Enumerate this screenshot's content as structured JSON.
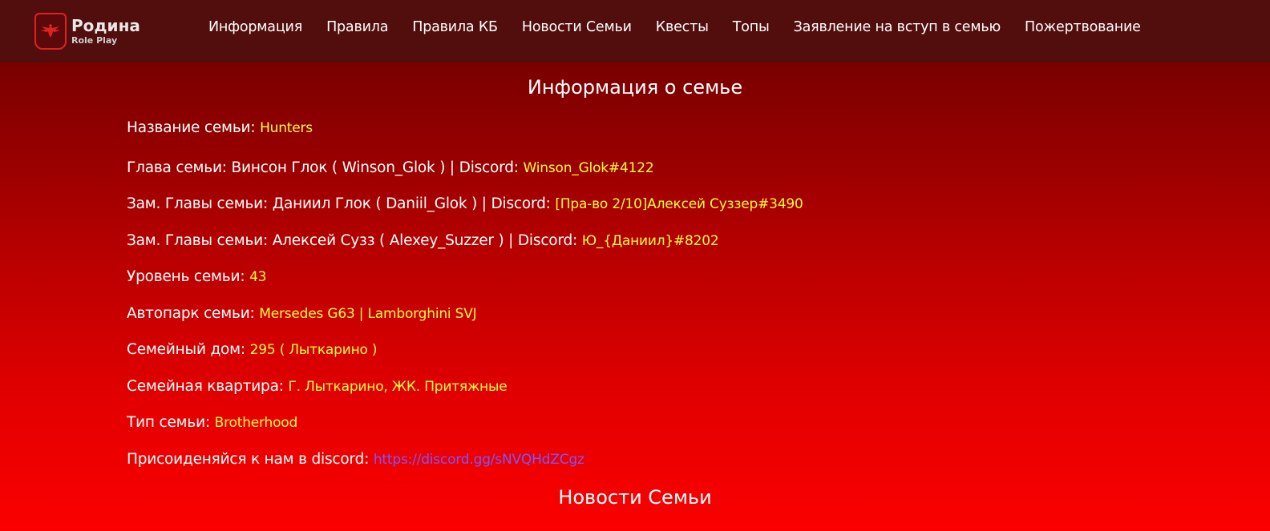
{
  "brand": {
    "title": "Родина",
    "subtitle": "Role Play",
    "logo_icon": "eagle-emblem-icon"
  },
  "nav": {
    "items": [
      {
        "label": "Информация"
      },
      {
        "label": "Правила"
      },
      {
        "label": "Правила КБ"
      },
      {
        "label": "Новости Семьи"
      },
      {
        "label": "Квесты"
      },
      {
        "label": "Топы"
      },
      {
        "label": "Заявление на вступ в семью"
      },
      {
        "label": "Пожертвование"
      }
    ]
  },
  "family_info": {
    "heading": "Информация о семье",
    "rows": [
      {
        "label": "Название семьи:",
        "value": "Hunters"
      },
      {
        "label": "Глава семьи: Винсон Глок ( Winson_Glok ) | Discord:",
        "value": "Winson_Glok#4122"
      },
      {
        "label": "Зам. Главы семьи: Даниил Глок ( Daniil_Glok ) | Discord:",
        "value": "[Пра-во 2/10]Алексей Суззер#3490"
      },
      {
        "label": "Зам. Главы семьи: Алексей Сузз ( Alexey_Suzzer ) | Discord:",
        "value": "Ю_{Даниил}#8202"
      },
      {
        "label": "Уровень семьи:",
        "value": "43"
      },
      {
        "label": "Автопарк семьи:",
        "value": "Mersedes G63 | Lamborghini SVJ"
      },
      {
        "label": "Семейный дом:",
        "value": "295 ( Лыткарино )"
      },
      {
        "label": "Семейная квартира:",
        "value": "Г. Лыткарино, ЖК. Притяжные"
      },
      {
        "label": "Тип семьи:",
        "value": "Brotherhood"
      }
    ],
    "discord": {
      "label": "Присоиденяйся к нам в discord:",
      "link": "https://discord.gg/sNVQHdZCgz"
    }
  },
  "news": {
    "heading": "Новости Семьи"
  },
  "colors": {
    "header_bg": "#520d0d",
    "value_yellow": "#fdfd3c",
    "link_purple": "#7b55ff"
  }
}
